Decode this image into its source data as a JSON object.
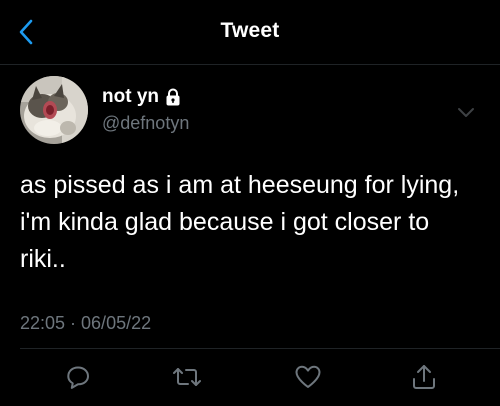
{
  "header": {
    "title": "Tweet",
    "back_icon": "chevron-left-icon"
  },
  "colors": {
    "background": "#000000",
    "accent": "#1d9bf0",
    "text_primary": "#ffffff",
    "text_secondary": "#6e767d",
    "divider": "#1f2326"
  },
  "tweet": {
    "author": {
      "display_name": "not yn",
      "handle": "@defnotyn",
      "protected_icon": "lock-icon",
      "avatar": "cat-avatar"
    },
    "text": "as pissed as i am at heeseung for lying, i'm kinda glad because i got closer to riki..",
    "timestamp": "22:05 · 06/05/22",
    "more_icon": "chevron-down-icon"
  },
  "actions": [
    {
      "name": "reply",
      "icon": "reply-icon"
    },
    {
      "name": "retweet",
      "icon": "retweet-icon"
    },
    {
      "name": "like",
      "icon": "heart-icon"
    },
    {
      "name": "share",
      "icon": "share-icon"
    }
  ]
}
